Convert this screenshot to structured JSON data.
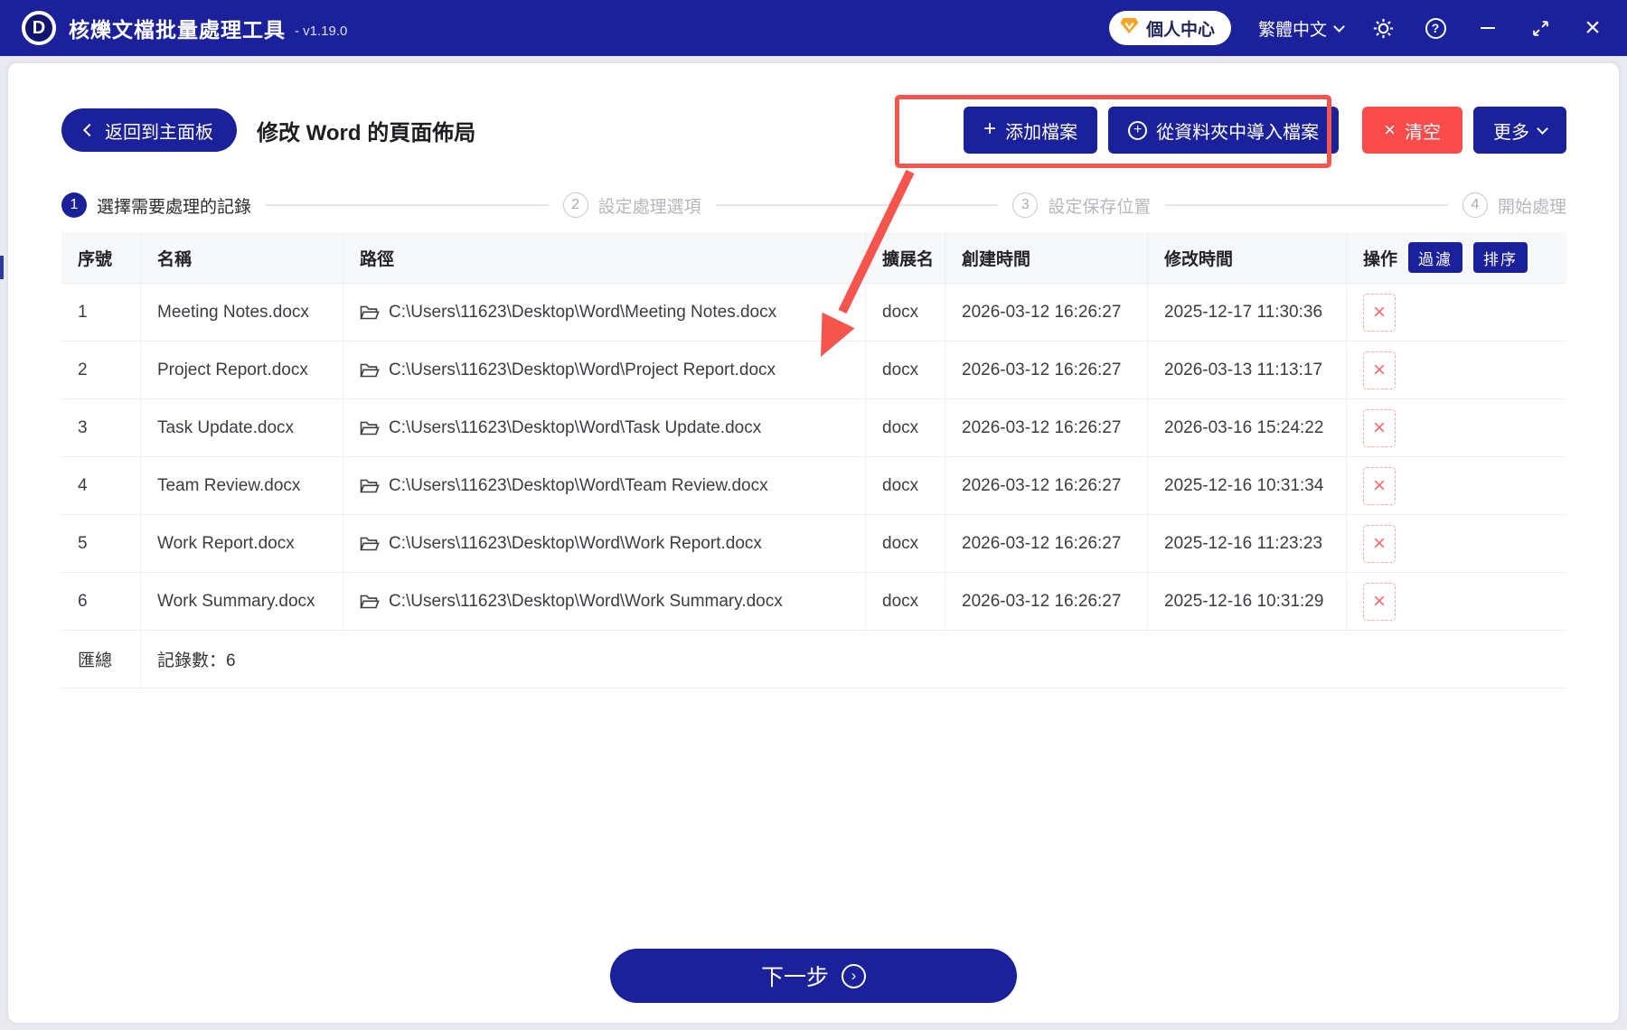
{
  "titlebar": {
    "logo_letter": "D",
    "app_title": "核爍文檔批量處理工具",
    "version": "- v1.19.0",
    "user_center": "個人中心",
    "language": "繁體中文"
  },
  "header": {
    "back_label": "返回到主面板",
    "page_title": "修改 Word 的頁面佈局",
    "add_files_label": "添加檔案",
    "import_folder_label": "從資料夾中導入檔案",
    "clear_label": "清空",
    "more_label": "更多"
  },
  "steps": [
    {
      "num": "1",
      "label": "選擇需要處理的記錄"
    },
    {
      "num": "2",
      "label": "設定處理選項"
    },
    {
      "num": "3",
      "label": "設定保存位置"
    },
    {
      "num": "4",
      "label": "開始處理"
    }
  ],
  "table": {
    "headers": {
      "index": "序號",
      "name": "名稱",
      "path": "路徑",
      "ext": "擴展名",
      "created": "創建時間",
      "modified": "修改時間",
      "actions": "操作"
    },
    "filter_label": "過濾",
    "sort_label": "排序",
    "rows": [
      {
        "index": "1",
        "name": "Meeting Notes.docx",
        "path": "C:\\Users\\11623\\Desktop\\Word\\Meeting Notes.docx",
        "ext": "docx",
        "created": "2026-03-12 16:26:27",
        "modified": "2025-12-17 11:30:36"
      },
      {
        "index": "2",
        "name": "Project Report.docx",
        "path": "C:\\Users\\11623\\Desktop\\Word\\Project Report.docx",
        "ext": "docx",
        "created": "2026-03-12 16:26:27",
        "modified": "2026-03-13 11:13:17"
      },
      {
        "index": "3",
        "name": "Task Update.docx",
        "path": "C:\\Users\\11623\\Desktop\\Word\\Task Update.docx",
        "ext": "docx",
        "created": "2026-03-12 16:26:27",
        "modified": "2026-03-16 15:24:22"
      },
      {
        "index": "4",
        "name": "Team Review.docx",
        "path": "C:\\Users\\11623\\Desktop\\Word\\Team Review.docx",
        "ext": "docx",
        "created": "2026-03-12 16:26:27",
        "modified": "2025-12-16 10:31:34"
      },
      {
        "index": "5",
        "name": "Work Report.docx",
        "path": "C:\\Users\\11623\\Desktop\\Word\\Work Report.docx",
        "ext": "docx",
        "created": "2026-03-12 16:26:27",
        "modified": "2025-12-16 11:23:23"
      },
      {
        "index": "6",
        "name": "Work Summary.docx",
        "path": "C:\\Users\\11623\\Desktop\\Word\\Work Summary.docx",
        "ext": "docx",
        "created": "2026-03-12 16:26:27",
        "modified": "2025-12-16 10:31:29"
      }
    ],
    "summary_label": "匯總",
    "summary_value": "記錄數：6"
  },
  "footer": {
    "next_label": "下一步"
  },
  "colors": {
    "primary": "#1b219b",
    "danger": "#fb4b4b",
    "annotation": "#f5554c"
  }
}
